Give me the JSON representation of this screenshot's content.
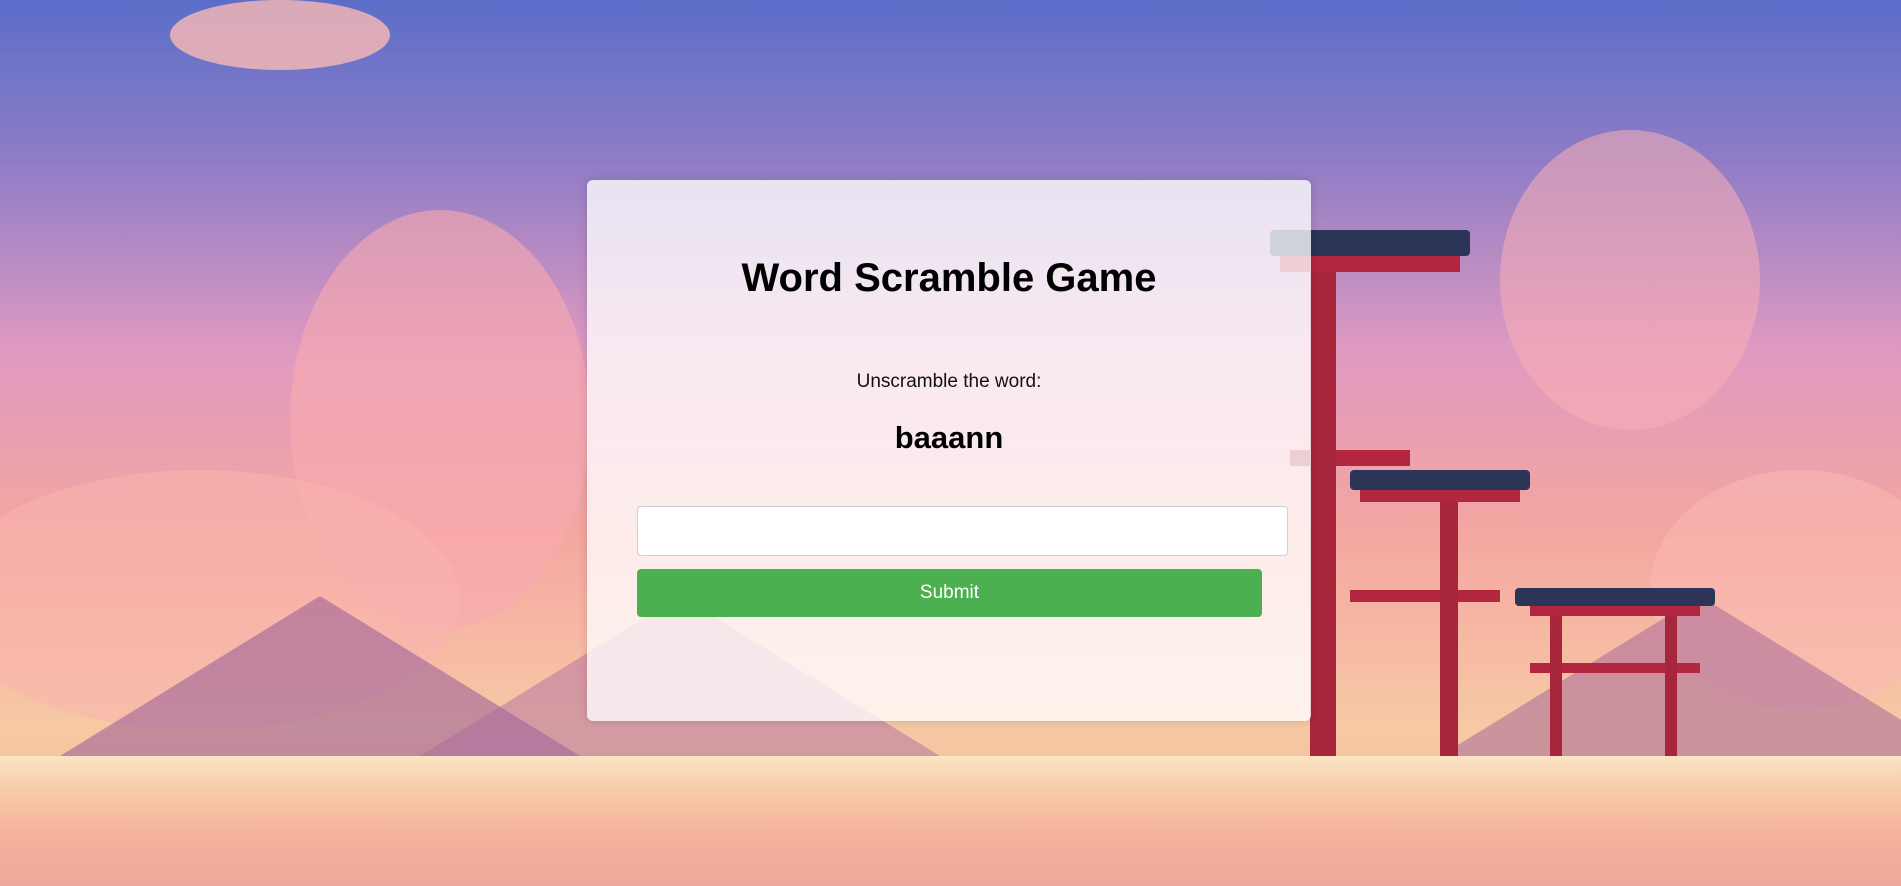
{
  "game": {
    "title": "Word Scramble Game",
    "prompt": "Unscramble the word:",
    "scrambled_word": "baaann"
  },
  "answer": {
    "value": "",
    "placeholder": ""
  },
  "submit": {
    "label": "Submit"
  },
  "colors": {
    "submit_button": "#4caf50",
    "card_background": "rgba(255,255,255,0.78)"
  }
}
